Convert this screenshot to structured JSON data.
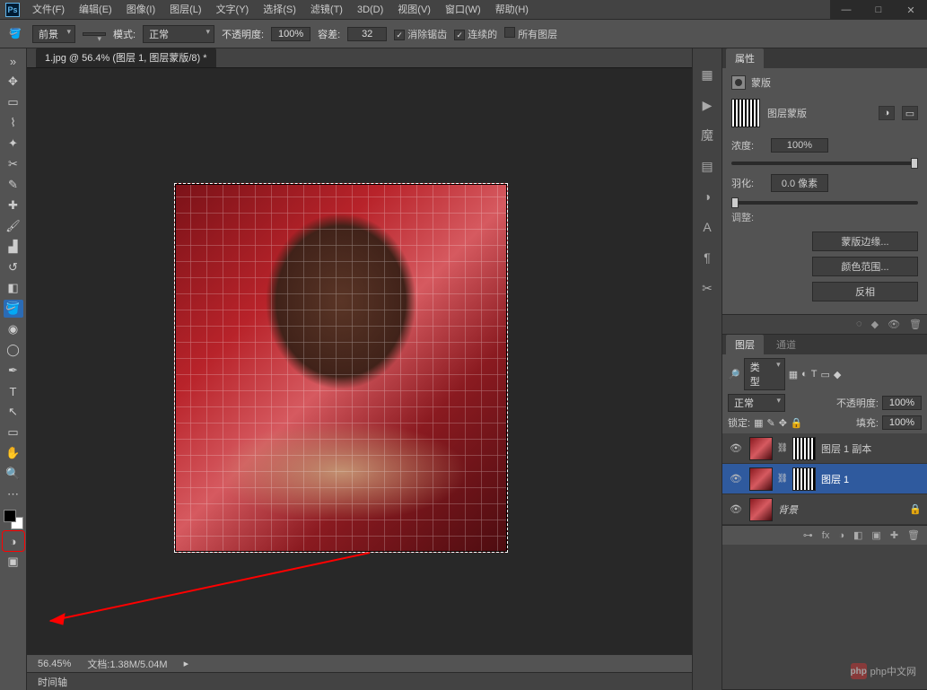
{
  "app": {
    "logo": "Ps"
  },
  "menu": [
    "文件(F)",
    "编辑(E)",
    "图像(I)",
    "图层(L)",
    "文字(Y)",
    "选择(S)",
    "滤镜(T)",
    "3D(D)",
    "视图(V)",
    "窗口(W)",
    "帮助(H)"
  ],
  "window_buttons": {
    "min": "—",
    "max": "□",
    "close": "✕"
  },
  "options": {
    "fill_target_label": "前景",
    "mode_label": "模式:",
    "mode_value": "正常",
    "opacity_label": "不透明度:",
    "opacity_value": "100%",
    "tolerance_label": "容差:",
    "tolerance_value": "32",
    "antialias_label": "消除锯齿",
    "contiguous_label": "连续的",
    "alllayers_label": "所有图层",
    "antialias_checked": "✓",
    "contiguous_checked": "✓",
    "alllayers_checked": ""
  },
  "doc_tab": "1.jpg @ 56.4% (图层 1, 图层蒙版/8) *",
  "status": {
    "zoom": "56.45%",
    "docinfo": "文档:1.38M/5.04M"
  },
  "timeline_tab": "时间轴",
  "dock_icons": [
    "▦",
    "▶",
    "魔",
    "▤",
    "◑",
    "A",
    "¶",
    "✂"
  ],
  "properties": {
    "tab": "属性",
    "title": "蒙版",
    "kind": "图层蒙版",
    "density_label": "浓度:",
    "density_value": "100%",
    "feather_label": "羽化:",
    "feather_value": "0.0 像素",
    "adjust_label": "调整:",
    "btn_edge": "蒙版边缘...",
    "btn_range": "颜色范围...",
    "btn_invert": "反相"
  },
  "layers": {
    "tab_layers": "图层",
    "tab_channels": "通道",
    "kind_label": "类型",
    "filter_icons": [
      "▦",
      "◐",
      "T",
      "▭",
      "◆"
    ],
    "blend_mode": "正常",
    "opacity_label": "不透明度:",
    "opacity_value": "100%",
    "lock_label": "锁定:",
    "lock_icons": [
      "▦",
      "✎",
      "✥",
      "🔒"
    ],
    "fill_label": "填充:",
    "fill_value": "100%",
    "items": [
      {
        "name": "图层 1 副本",
        "has_mask": true,
        "active": false
      },
      {
        "name": "图层 1",
        "has_mask": true,
        "active": true
      },
      {
        "name": "背景",
        "has_mask": false,
        "active": false,
        "locked": true
      }
    ],
    "footer_icons": [
      "⊶",
      "fx",
      "◑",
      "◧",
      "▣",
      "✚",
      "🗑"
    ]
  },
  "watermark": "php中文网"
}
